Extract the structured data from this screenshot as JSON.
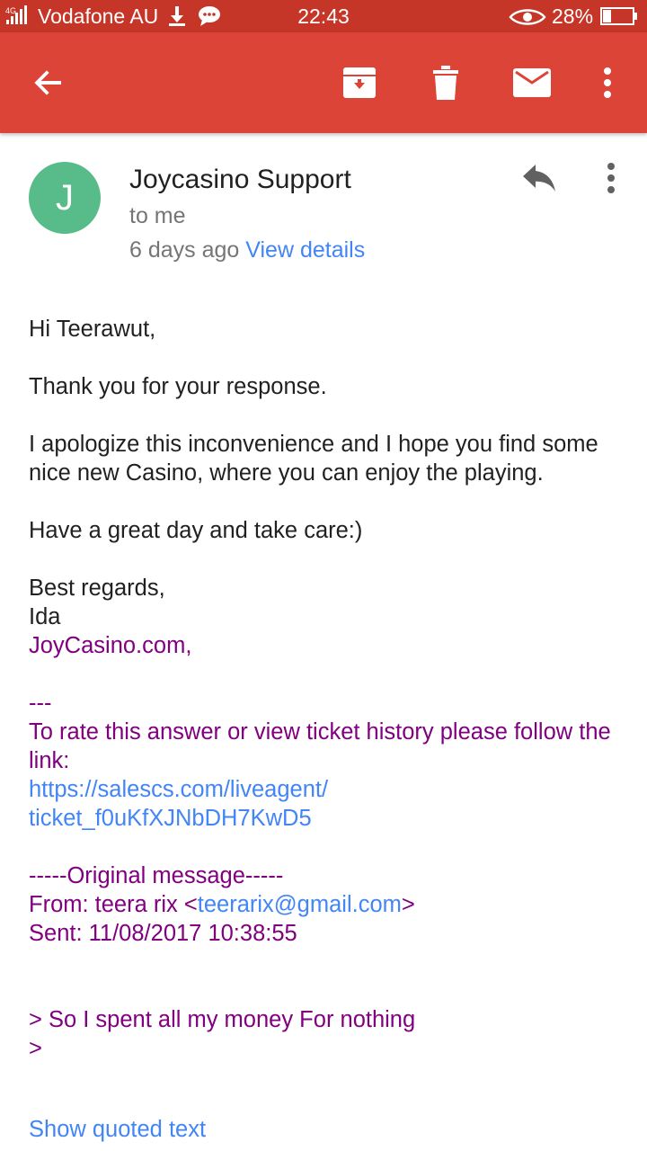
{
  "status_bar": {
    "network": "4G",
    "carrier": "Vodafone AU",
    "time": "22:43",
    "battery_percent": "28%",
    "battery_level": 0.28
  },
  "toolbar": {
    "back_icon": "arrow-left-icon",
    "archive_icon": "archive-icon",
    "delete_icon": "trash-icon",
    "mark_unread_icon": "mail-icon",
    "more_icon": "more-vertical-icon",
    "color": "#db4437"
  },
  "header": {
    "avatar_letter": "J",
    "avatar_color": "#57bb8a",
    "sender": "Joycasino Support",
    "recipient": "to me",
    "time_ago": "6 days ago",
    "view_details": "View details"
  },
  "message": {
    "greeting": "Hi Teerawut,",
    "line1": "Thank you for your response.",
    "line2": "I apologize this inconvenience and I hope you find some nice new Casino, where you can enjoy the playing.",
    "line3": "Have a great day and take care:)",
    "closing": "Best regards,",
    "signer": "Ida",
    "company": "JoyCasino.com,",
    "separator": "---",
    "rate_text": "To rate this answer or view ticket history please follow the link:",
    "ticket_link_1": "https://salescs.com/liveagent/",
    "ticket_link_2": "ticket_f0uKfXJNbDH7KwD5",
    "original_header": "-----Original message-----",
    "from_prefix": "From: teera rix <",
    "from_email": "teerarix@gmail.com",
    "from_suffix": ">",
    "sent": "Sent: 11/08/2017 10:38:55",
    "quote_line1": "> So I spent all my money For nothing",
    "quote_line2": ">",
    "show_quoted": "Show quoted text"
  }
}
